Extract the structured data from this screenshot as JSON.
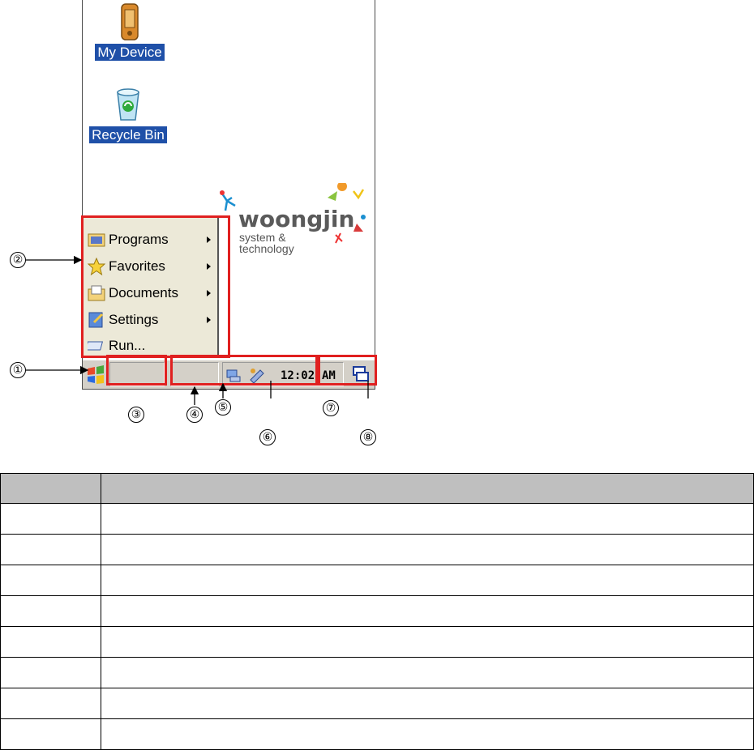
{
  "desktop": {
    "icons": [
      {
        "label": "My Device",
        "icon": "pda-device-icon"
      },
      {
        "label": "Recycle Bin",
        "icon": "recycle-bin-icon"
      }
    ],
    "logo": {
      "word": "woongjin",
      "sub_line1": "system &",
      "sub_line2": "technology"
    }
  },
  "start_menu": {
    "items": [
      {
        "label": "Programs",
        "icon": "programs-folder-icon",
        "submenu": true
      },
      {
        "label": "Favorites",
        "icon": "star-icon",
        "submenu": true
      },
      {
        "label": "Documents",
        "icon": "documents-folder-icon",
        "submenu": true
      },
      {
        "label": "Settings",
        "icon": "settings-icon",
        "submenu": true
      },
      {
        "label": "Run...",
        "icon": "run-icon",
        "submenu": false
      }
    ]
  },
  "taskbar": {
    "clock": "12:02",
    "ampm": "AM"
  },
  "callouts": [
    "①",
    "②",
    "③",
    "④",
    "⑤",
    "⑥",
    "⑦",
    "⑧"
  ],
  "colors": {
    "highlight": "#e02020",
    "selection": "#1f50a8",
    "taskbar": "#d4d0c8"
  }
}
